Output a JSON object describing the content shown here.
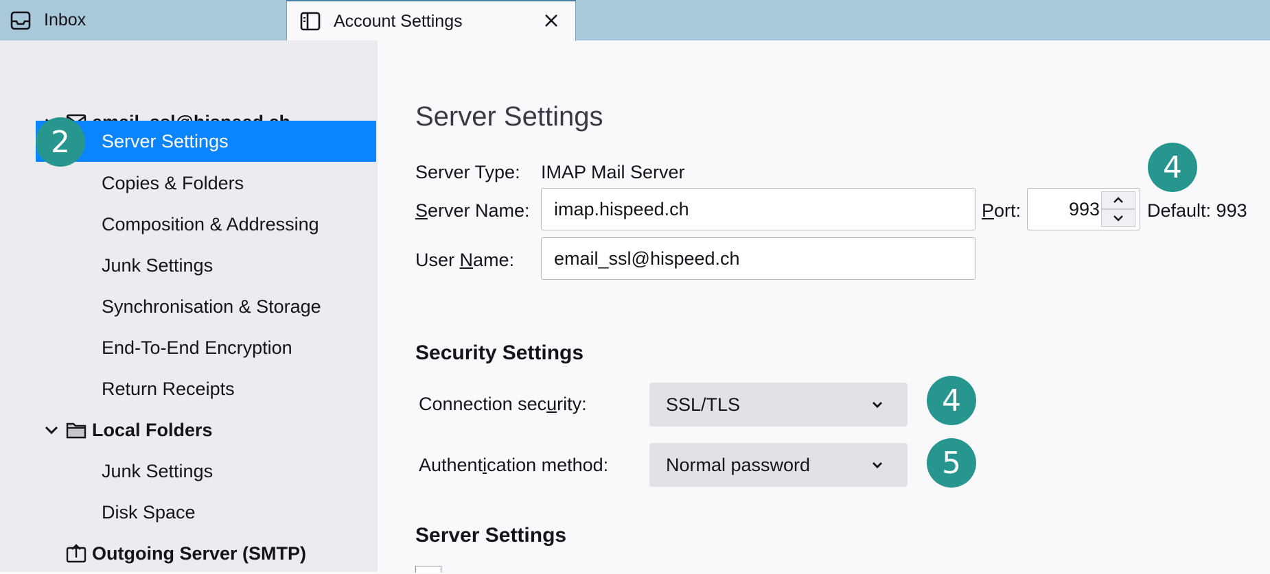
{
  "tabs": [
    {
      "label": "Inbox",
      "icon": "inbox-icon"
    },
    {
      "label": "Account Settings",
      "icon": "account-settings-icon",
      "close_icon": "close-icon"
    }
  ],
  "sidebar": {
    "account": {
      "label": "email_ssl@hispeed.ch",
      "icon": "envelope-icon"
    },
    "account_items": [
      {
        "label": "Server Settings",
        "selected": true
      },
      {
        "label": "Copies & Folders"
      },
      {
        "label": "Composition & Addressing"
      },
      {
        "label": "Junk Settings"
      },
      {
        "label": "Synchronisation & Storage"
      },
      {
        "label": "End-To-End Encryption"
      },
      {
        "label": "Return Receipts"
      }
    ],
    "local_folders": {
      "label": "Local Folders",
      "icon": "folder-icon"
    },
    "local_items": [
      {
        "label": "Junk Settings"
      },
      {
        "label": "Disk Space"
      }
    ],
    "outgoing": {
      "label": "Outgoing Server (SMTP)",
      "icon": "outgoing-server-icon"
    }
  },
  "badges": {
    "b1": "2",
    "b2": "4",
    "b3": "4",
    "b4": "5"
  },
  "main": {
    "title": "Server Settings",
    "server_type_label": "Server Type:",
    "server_type_value": "IMAP Mail Server",
    "server_name_label_u": "S",
    "server_name_label_rest": "erver Name:",
    "server_name_value": "imap.hispeed.ch",
    "port_label_u": "P",
    "port_label_rest": "ort:",
    "port_value": "993",
    "port_default": "Default: 993",
    "user_name_label_pre": "User ",
    "user_name_label_u": "N",
    "user_name_label_rest": "ame:",
    "user_name_value": "email_ssl@hispeed.ch",
    "security_heading": "Security Settings",
    "conn_label_pre": "Connection sec",
    "conn_label_u": "u",
    "conn_label_rest": "rity:",
    "conn_value": "SSL/TLS",
    "auth_label_pre": "Authent",
    "auth_label_u": "i",
    "auth_label_rest": "cation method:",
    "auth_value": "Normal password",
    "server_settings_heading": "Server Settings"
  },
  "colors": {
    "selection": "#0a84ff",
    "badge": "#26968f",
    "tabbar": "#a9c8da"
  }
}
